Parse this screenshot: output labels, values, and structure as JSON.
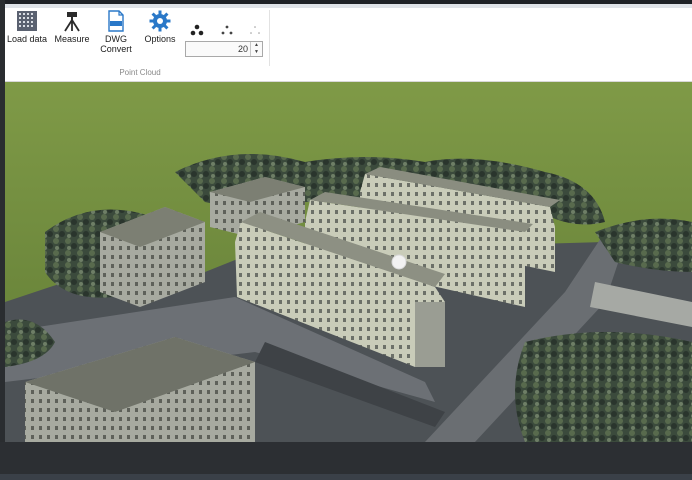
{
  "ribbon": {
    "tools": [
      {
        "label": "Load data",
        "icon": "point-cloud-grid-icon"
      },
      {
        "label": "Measure",
        "icon": "tripod-survey-icon"
      },
      {
        "label": "DWG\nConvert",
        "icon": "dwg-file-icon"
      },
      {
        "label": "Options",
        "icon": "gear-icon"
      }
    ],
    "point_size": {
      "value": "20"
    },
    "group_label": "Point Cloud"
  },
  "colors": {
    "accent": "#2a78c8",
    "grass": "#6e8a3a",
    "building_wall": "#c8cbb6",
    "roof": "#8c8e7e",
    "road": "#55585c"
  }
}
